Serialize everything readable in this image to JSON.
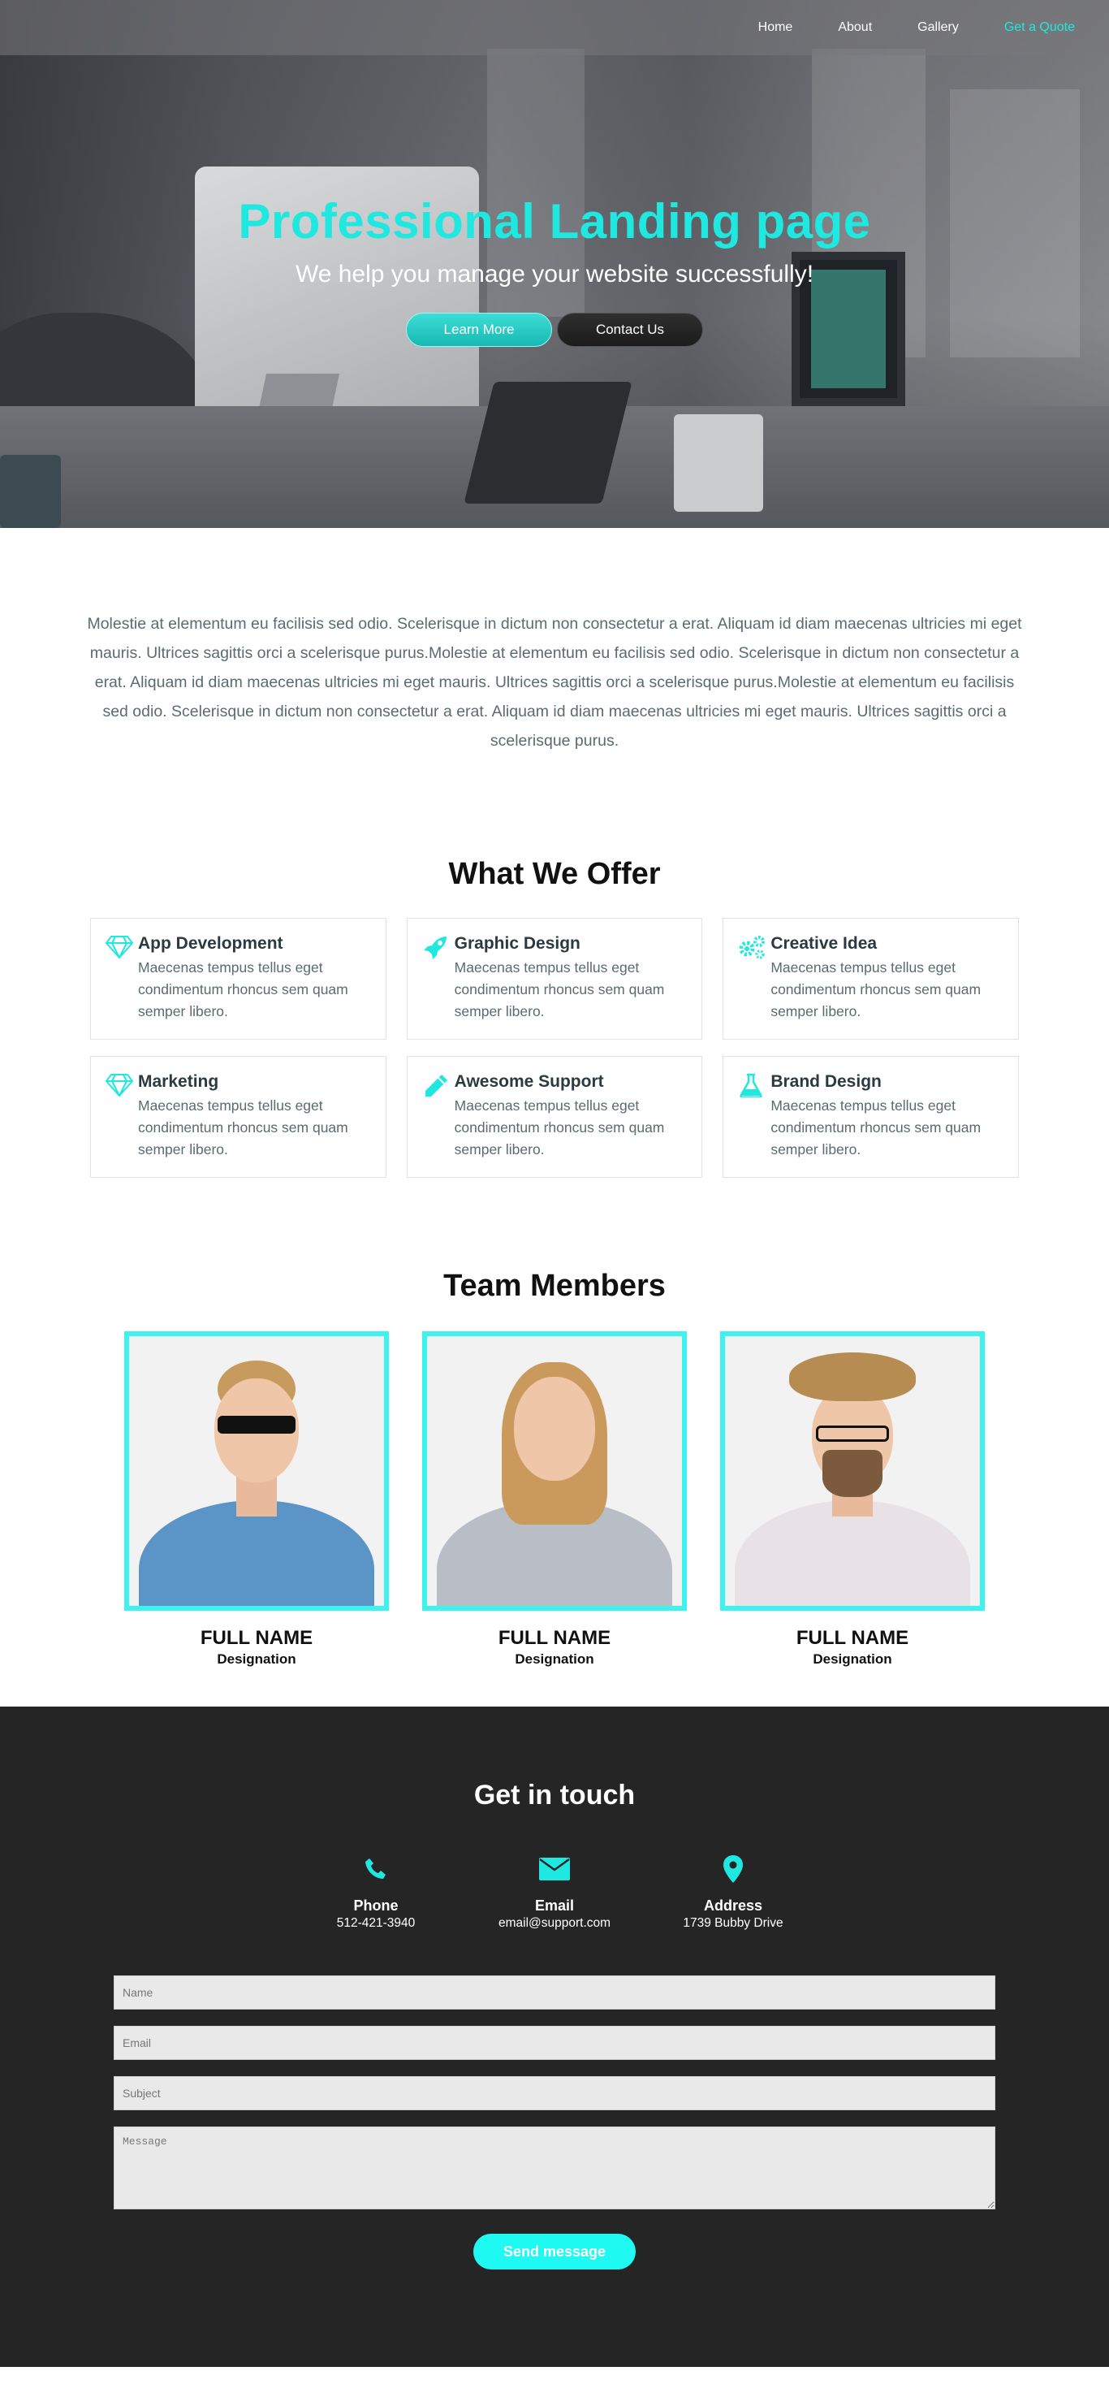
{
  "colors": {
    "accent": "#1ee8df",
    "dark": "#252525",
    "photo_border": "#3df3ee"
  },
  "nav": {
    "items": [
      {
        "label": "Home"
      },
      {
        "label": "About"
      },
      {
        "label": "Gallery"
      },
      {
        "label": "Get a Quote",
        "accent": true
      }
    ]
  },
  "hero": {
    "title": "Professional Landing page",
    "subtitle": "We help you manage your website successfully!",
    "learn_more_label": "Learn More",
    "contact_us_label": "Contact Us"
  },
  "intro": {
    "text": "Molestie at elementum eu facilisis sed odio. Scelerisque in dictum non consectetur a erat. Aliquam id diam maecenas ultricies mi eget mauris. Ultrices sagittis orci a scelerisque purus.Molestie at elementum eu facilisis sed odio. Scelerisque in dictum non consectetur a erat. Aliquam id diam maecenas ultricies mi eget mauris. Ultrices sagittis orci a scelerisque purus.Molestie at elementum eu facilisis sed odio. Scelerisque in dictum non consectetur a erat. Aliquam id diam maecenas ultricies mi eget mauris. Ultrices sagittis orci a scelerisque purus."
  },
  "services": {
    "title": "What We Offer",
    "items": [
      {
        "title": "App Development",
        "icon": "diamond-icon",
        "text": "Maecenas tempus tellus eget condimentum rhoncus sem quam semper libero."
      },
      {
        "title": "Graphic Design",
        "icon": "rocket-icon",
        "text": "Maecenas tempus tellus eget condimentum rhoncus sem quam semper libero."
      },
      {
        "title": "Creative Idea",
        "icon": "gears-icon",
        "text": "Maecenas tempus tellus eget condimentum rhoncus sem quam semper libero."
      },
      {
        "title": "Marketing",
        "icon": "diamond-icon",
        "text": "Maecenas tempus tellus eget condimentum rhoncus sem quam semper libero."
      },
      {
        "title": "Awesome Support",
        "icon": "pencil-icon",
        "text": "Maecenas tempus tellus eget condimentum rhoncus sem quam semper libero."
      },
      {
        "title": "Brand Design",
        "icon": "flask-icon",
        "text": "Maecenas tempus tellus eget condimentum rhoncus sem quam semper libero."
      }
    ]
  },
  "team": {
    "title": "Team Members",
    "members": [
      {
        "name": "FULL NAME",
        "role": "Designation"
      },
      {
        "name": "FULL NAME",
        "role": "Designation"
      },
      {
        "name": "FULL NAME",
        "role": "Designation"
      }
    ]
  },
  "contact": {
    "title": "Get in touch",
    "info": [
      {
        "label": "Phone",
        "value": "512-421-3940",
        "icon": "phone-icon"
      },
      {
        "label": "Email",
        "value": "email@support.com",
        "icon": "envelope-icon"
      },
      {
        "label": "Address",
        "value": "1739 Bubby Drive",
        "icon": "map-pin-icon"
      }
    ],
    "form": {
      "name_placeholder": "Name",
      "email_placeholder": "Email",
      "subject_placeholder": "Subject",
      "message_placeholder": "Message",
      "send_label": "Send message"
    }
  }
}
